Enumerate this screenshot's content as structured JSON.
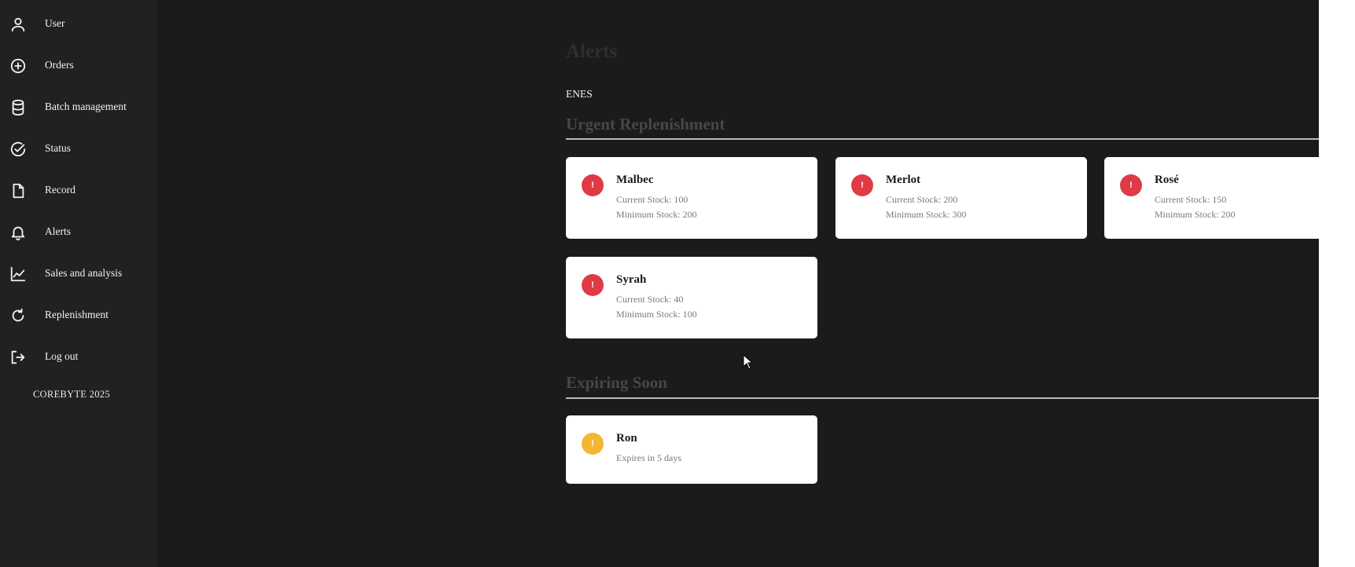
{
  "sidebar": {
    "items": [
      {
        "label": "User",
        "icon": "user-icon"
      },
      {
        "label": "Orders",
        "icon": "plus-circle-icon"
      },
      {
        "label": "Batch management",
        "icon": "database-icon"
      },
      {
        "label": "Status",
        "icon": "check-circle-icon"
      },
      {
        "label": "Record",
        "icon": "document-icon"
      },
      {
        "label": "Alerts",
        "icon": "bell-icon"
      },
      {
        "label": "Sales and analysis",
        "icon": "chart-line-icon"
      },
      {
        "label": "Replenishment",
        "icon": "refresh-icon"
      },
      {
        "label": "Log out",
        "icon": "logout-icon"
      }
    ],
    "footer": "COREBYTE 2025"
  },
  "main": {
    "title": "Alerts",
    "language_toggle": "ENES",
    "urgent": {
      "title": "Urgent Replenishment",
      "cards": [
        {
          "name": "Malbec",
          "current": "Current Stock: 100",
          "minimum": "Minimum Stock: 200",
          "badge": "!"
        },
        {
          "name": "Merlot",
          "current": "Current Stock: 200",
          "minimum": "Minimum Stock: 300",
          "badge": "!"
        },
        {
          "name": "Rosé",
          "current": "Current Stock: 150",
          "minimum": "Minimum Stock: 200",
          "badge": "!"
        },
        {
          "name": "Syrah",
          "current": "Current Stock: 40",
          "minimum": "Minimum Stock: 100",
          "badge": "!"
        }
      ]
    },
    "expiring": {
      "title": "Expiring Soon",
      "cards": [
        {
          "name": "Ron",
          "detail": "Expires in 5 days",
          "badge": "!"
        }
      ]
    }
  },
  "colors": {
    "background": "#1b1b1b",
    "sidebar": "#212121",
    "card": "#ffffff",
    "urgent_badge": "#e03a45",
    "expiring_badge": "#f3b731",
    "section_title": "#474747"
  }
}
